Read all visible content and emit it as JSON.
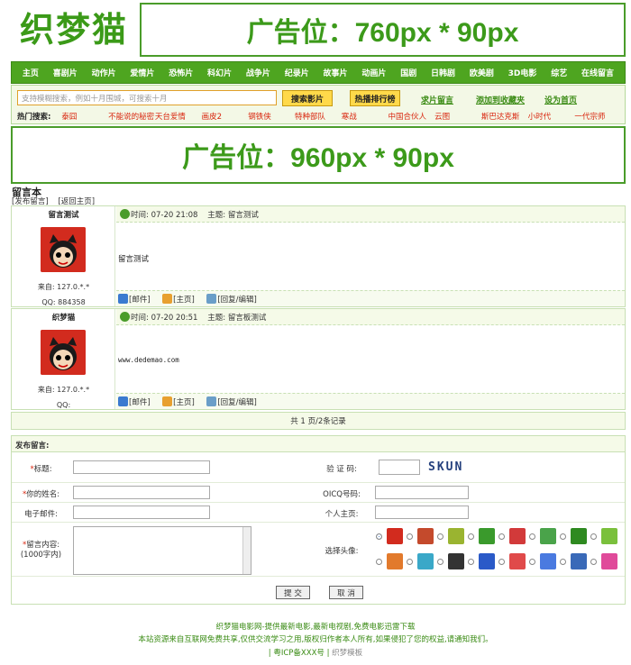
{
  "logo": {
    "text": "织梦猫"
  },
  "ads": {
    "top": "广告位：760px * 90px",
    "mid": "广告位：960px * 90px"
  },
  "nav": [
    "主页",
    "喜剧片",
    "动作片",
    "爱情片",
    "恐怖片",
    "科幻片",
    "战争片",
    "纪录片",
    "故事片",
    "动画片",
    "国剧",
    "日韩剧",
    "欧美剧",
    "3D电影",
    "综艺",
    "在线留言"
  ],
  "search": {
    "placeholder": "支持模糊搜索，例如十月围城，可搜索十月",
    "button": "搜索影片",
    "hot_button": "热播排行榜",
    "links": [
      "求片留言",
      "添加到收藏夹",
      "设为首页"
    ],
    "hot_label": "热门搜索:",
    "hot": [
      "泰囧",
      "不能说的秘密",
      "天台爱情",
      "画皮2",
      "钢铁侠",
      "特种部队",
      "寒战",
      "中国合伙人",
      "云图",
      "斯巴达克斯",
      "小时代",
      "一代宗师"
    ]
  },
  "page": {
    "title": "留言本",
    "post_link": "[发布留言]",
    "home_link": "[返回主页]"
  },
  "entries": [
    {
      "name": "留言测试",
      "time": "时间: 07-20 21:08",
      "subject": "主题: 留言测试",
      "message": "留言测试",
      "from": "来自: 127.0.*.*",
      "qq": "QQ: 884358",
      "actions": [
        "[邮件]",
        "[主页]",
        "[回复/编辑]"
      ]
    },
    {
      "name": "织梦猫",
      "time": "时间: 07-20 20:51",
      "subject": "主题: 留言板测试",
      "message": "www.dedemao.com",
      "from": "来自: 127.0.*.*",
      "qq": "QQ:",
      "actions": [
        "[邮件]",
        "[主页]",
        "[回复/编辑]"
      ]
    }
  ],
  "pager": "共 1 页/2条记录",
  "form": {
    "title": "发布留言:",
    "labels": {
      "subject": "标题:",
      "captcha": "验 证 码:",
      "name": "你的姓名:",
      "oicq": "OICQ号码:",
      "email": "电子邮件:",
      "homepage": "个人主页:",
      "content": "留言内容:",
      "content_hint": "(1000字内)",
      "avatar": "选择头像:"
    },
    "captcha_code": "SKUN",
    "submit": "提 交",
    "cancel": "取 消"
  },
  "footer": {
    "line1": "织梦猫电影网-提供最新电影,最新电视剧,免费电影迅雷下载",
    "line2": "本站资源来自互联网免费共享,仅供交流学习之用,版权归作者本人所有,如果侵犯了您的权益,请通知我们。",
    "icp": "| 粤ICP备XXX号 |",
    "tpl": "织梦模板"
  }
}
